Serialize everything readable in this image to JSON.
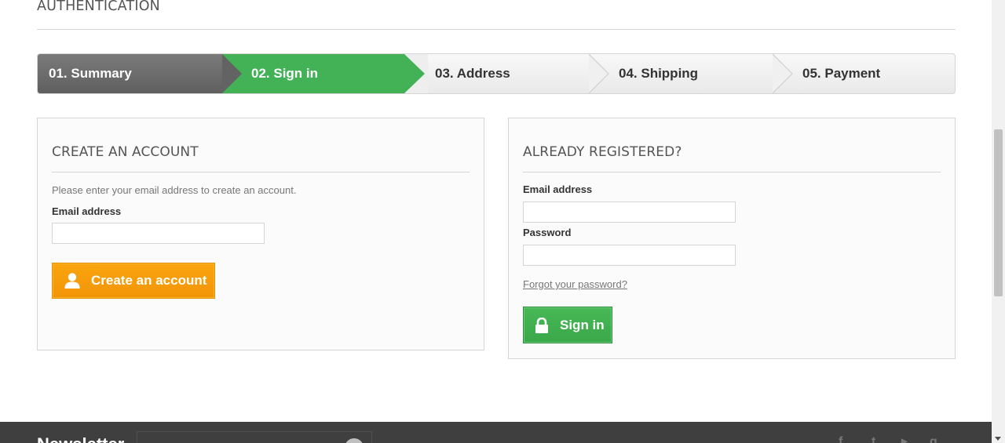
{
  "page": {
    "heading": "AUTHENTICATION"
  },
  "steps": [
    {
      "label": "01. Summary",
      "state": "done"
    },
    {
      "label": "02. Sign in",
      "state": "current"
    },
    {
      "label": "03. Address",
      "state": "todo"
    },
    {
      "label": "04. Shipping",
      "state": "todo"
    },
    {
      "label": "05. Payment",
      "state": "todo"
    }
  ],
  "create_account": {
    "title": "CREATE AN ACCOUNT",
    "hint": "Please enter your email address to create an account.",
    "email_label": "Email address",
    "email_value": "",
    "button_label": "Create an account",
    "button_icon": "user-icon"
  },
  "login": {
    "title": "ALREADY REGISTERED?",
    "email_label": "Email address",
    "email_value": "",
    "password_label": "Password",
    "password_value": "",
    "forgot_link": "Forgot your password?",
    "button_label": "Sign in",
    "button_icon": "lock-icon"
  },
  "footer": {
    "newsletter_label": "Newsletter",
    "newsletter_value": "",
    "social_icons": [
      "facebook-icon",
      "twitter-icon",
      "youtube-icon",
      "google-plus-icon"
    ]
  },
  "colors": {
    "step_done": "#666666",
    "step_current": "#43b155",
    "button_orange": "#f7a00c",
    "button_green": "#43b155",
    "footer_bg": "#3f3f3f"
  }
}
